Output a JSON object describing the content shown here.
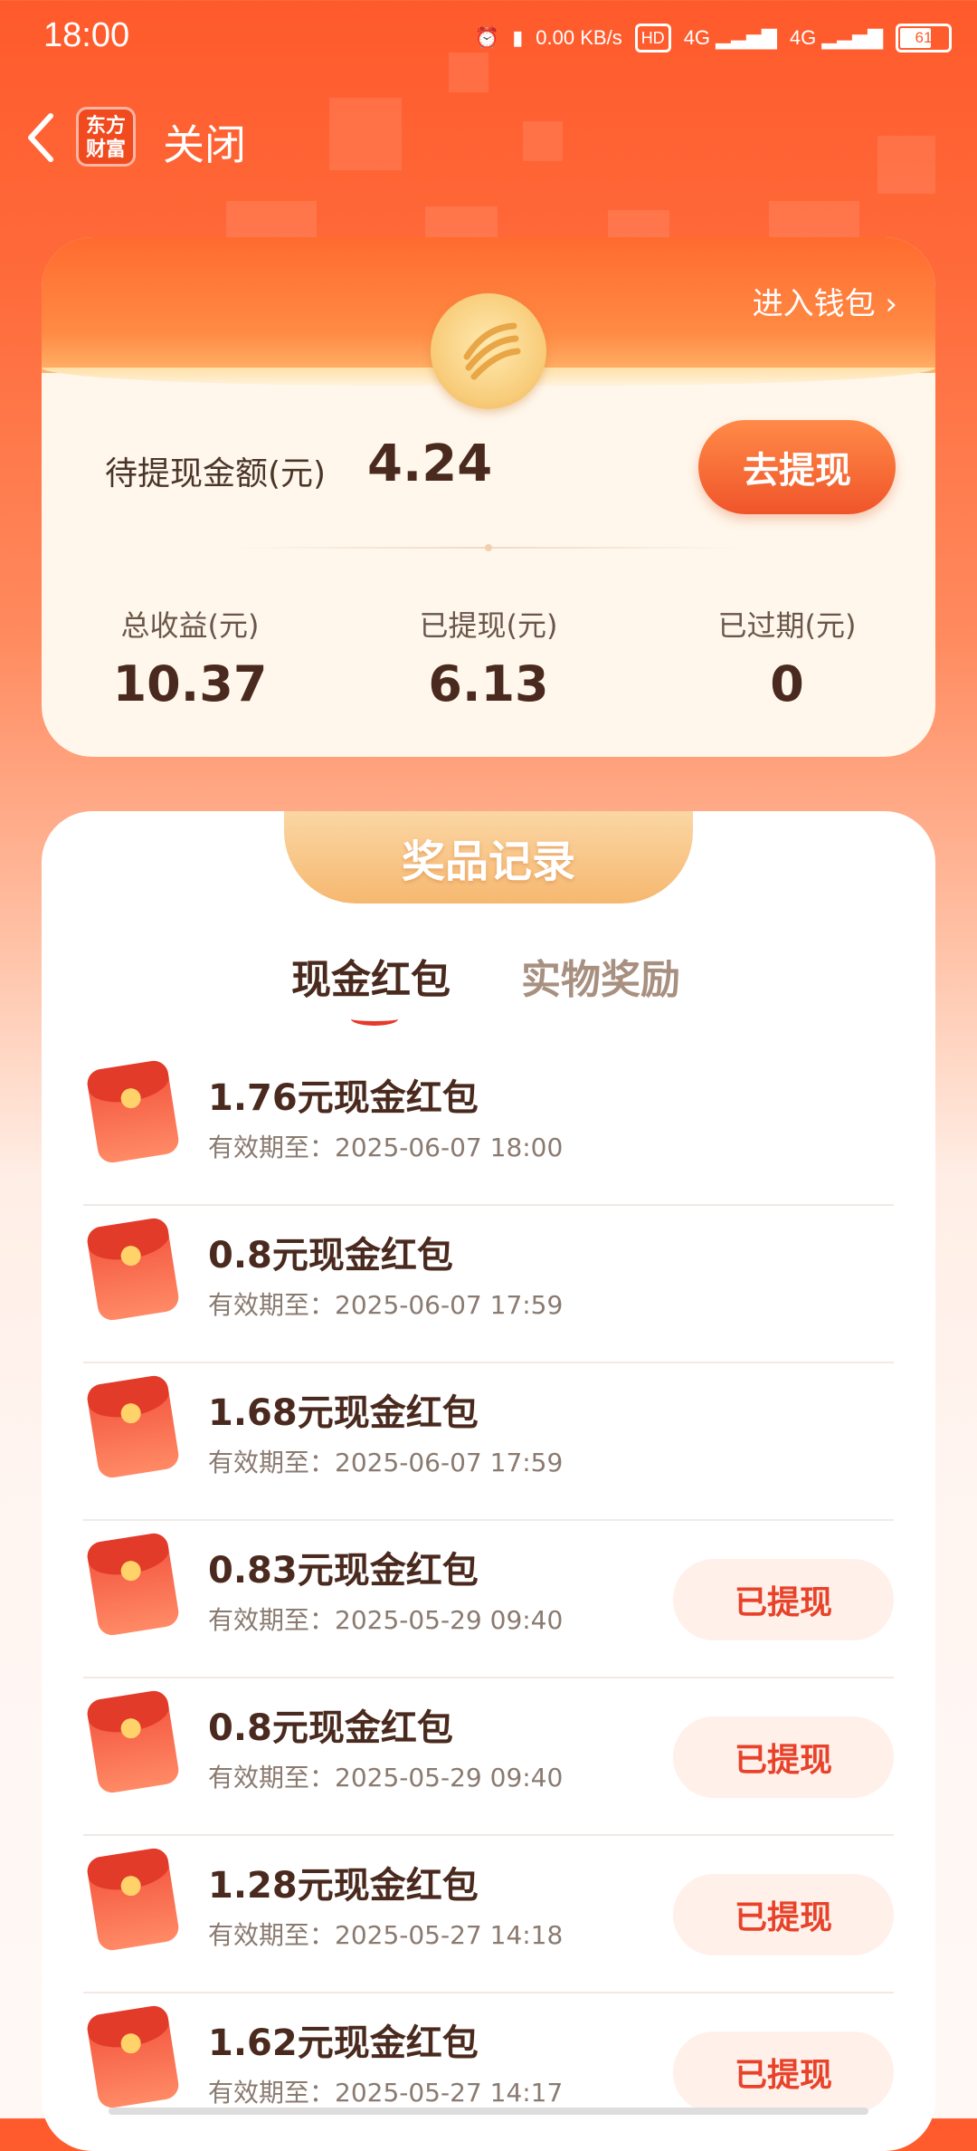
{
  "status_bar": {
    "time": "18:00",
    "network_speed": "0.00 KB/s",
    "hd": "HD",
    "sim1": "4G",
    "sim2": "4G",
    "battery": "61"
  },
  "nav": {
    "back_icon": "chevron-left-icon",
    "logo_text": "东方财富",
    "close_label": "关闭"
  },
  "wallet": {
    "enter_wallet_label": "进入钱包 ›",
    "pending_label": "待提现金额(元)",
    "pending_value": "4.24",
    "withdraw_button": "去提现",
    "stats": [
      {
        "label": "总收益(元)",
        "value": "10.37"
      },
      {
        "label": "已提现(元)",
        "value": "6.13"
      },
      {
        "label": "已过期(元)",
        "value": "0"
      }
    ]
  },
  "records": {
    "title": "奖品记录",
    "tabs": [
      {
        "label": "现金红包",
        "active": true
      },
      {
        "label": "实物奖励",
        "active": false
      }
    ],
    "date_prefix": "有效期至：",
    "items": [
      {
        "title": "1.76元现金红包",
        "date": "有效期至：2025-06-07 18:00",
        "action": ""
      },
      {
        "title": "0.8元现金红包",
        "date": "有效期至：2025-06-07 17:59",
        "action": ""
      },
      {
        "title": "1.68元现金红包",
        "date": "有效期至：2025-06-07 17:59",
        "action": ""
      },
      {
        "title": "0.83元现金红包",
        "date": "有效期至：2025-05-29 09:40",
        "action": "已提现"
      },
      {
        "title": "0.8元现金红包",
        "date": "有效期至：2025-05-29 09:40",
        "action": "已提现"
      },
      {
        "title": "1.28元现金红包",
        "date": "有效期至：2025-05-27 14:18",
        "action": "已提现"
      },
      {
        "title": "1.62元现金红包",
        "date": "有效期至：2025-05-27 14:17",
        "action": "已提现"
      }
    ]
  },
  "colors": {
    "brand_orange": "#ff5a2c",
    "withdrawn_text": "#e8432a",
    "title_brown": "#4a2a1e"
  }
}
